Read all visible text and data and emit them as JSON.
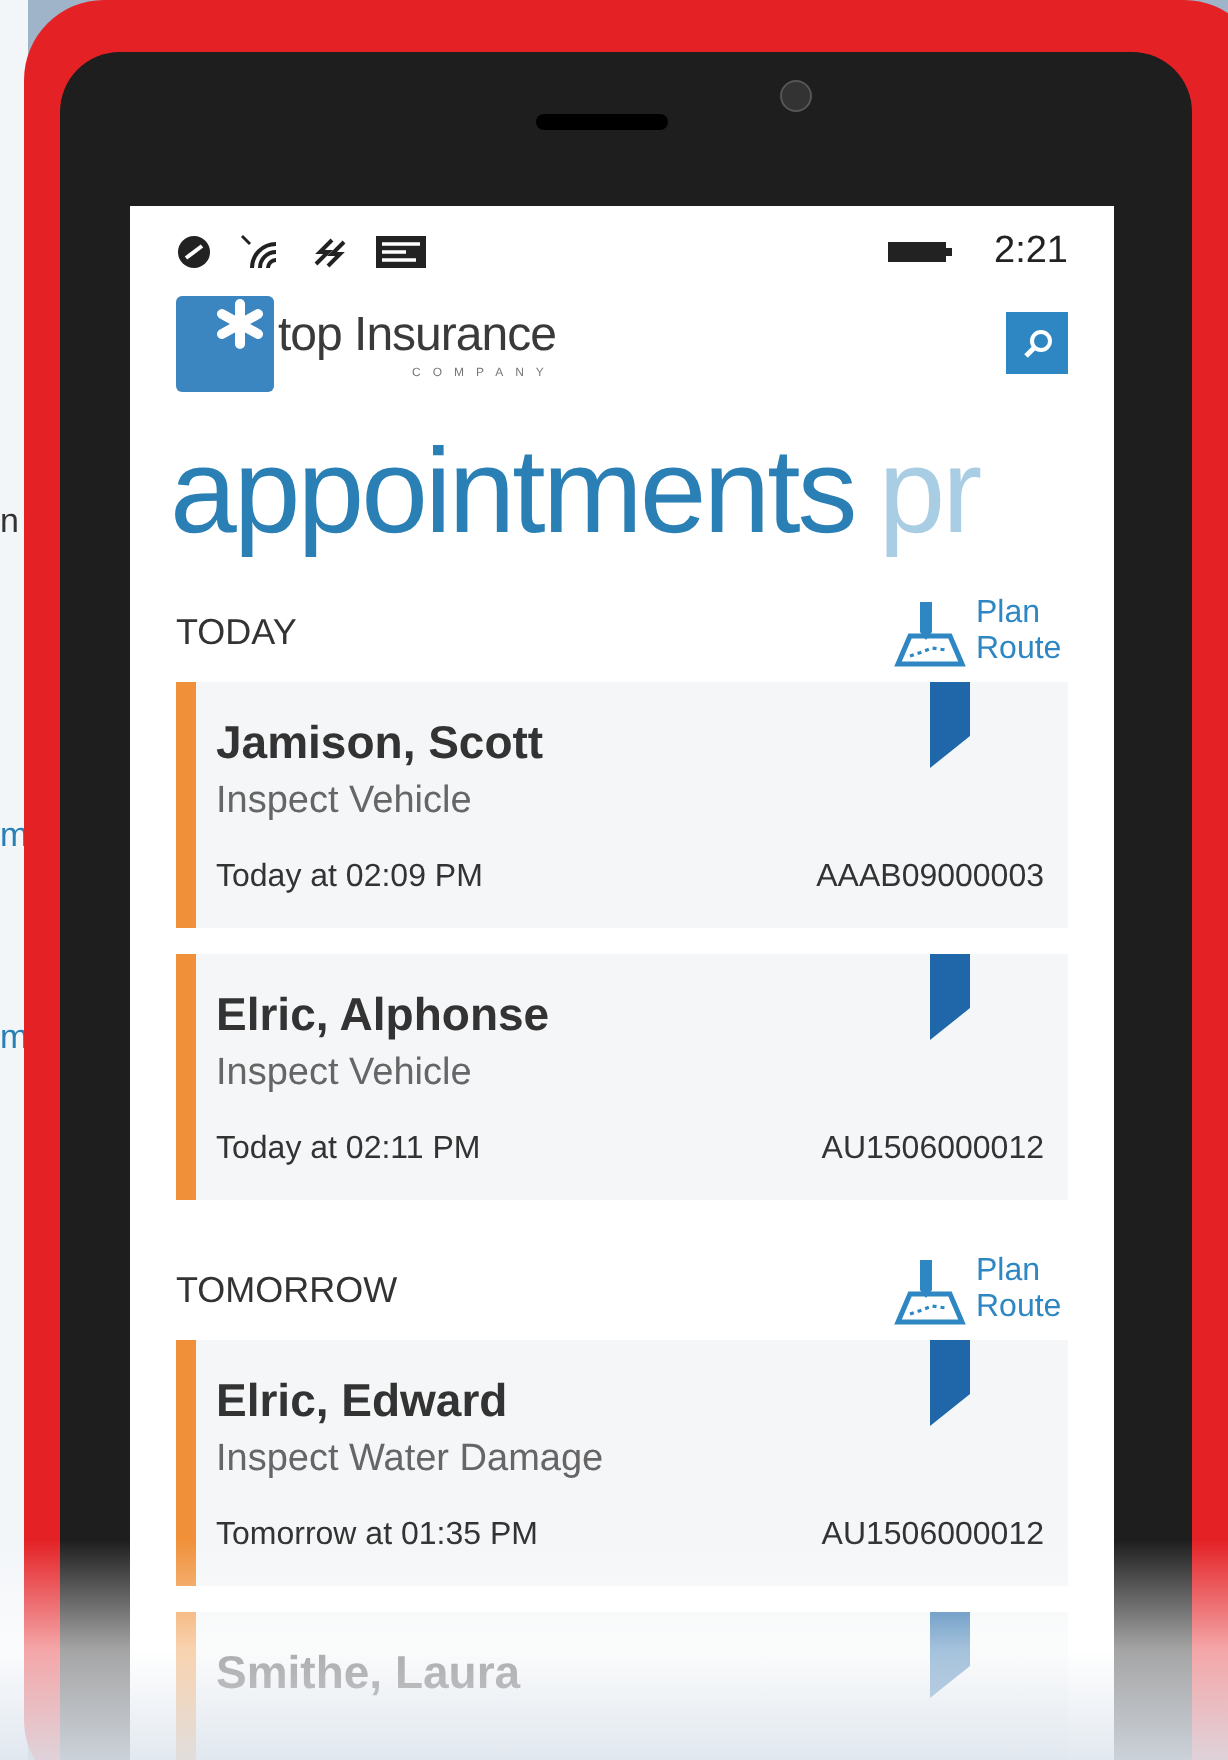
{
  "background_fragments": [
    {
      "text": "n"
    },
    {
      "text": "m"
    },
    {
      "text": "m"
    }
  ],
  "status_bar": {
    "time": "2:21"
  },
  "header": {
    "logo_text": "top Insurance",
    "logo_subtext": "COMPANY"
  },
  "pivot": [
    {
      "label": "appointments",
      "selected": true
    },
    {
      "label": "pr",
      "selected": false
    }
  ],
  "groups": [
    {
      "title": "TODAY",
      "action": "Plan Route",
      "appointments": [
        {
          "name": "Jamison, Scott",
          "task": "Inspect Vehicle",
          "when": "Today at 02:09 PM",
          "ref": "AAAB09000003"
        },
        {
          "name": "Elric, Alphonse",
          "task": "Inspect Vehicle",
          "when": "Today at 02:11 PM",
          "ref": "AU1506000012"
        }
      ]
    },
    {
      "title": "TOMORROW",
      "action": "Plan Route",
      "appointments": [
        {
          "name": "Elric, Edward",
          "task": "Inspect Water Damage",
          "when": "Tomorrow at 01:35 PM",
          "ref": "AU1506000012"
        },
        {
          "name": "Smithe, Laura"
        }
      ]
    }
  ]
}
